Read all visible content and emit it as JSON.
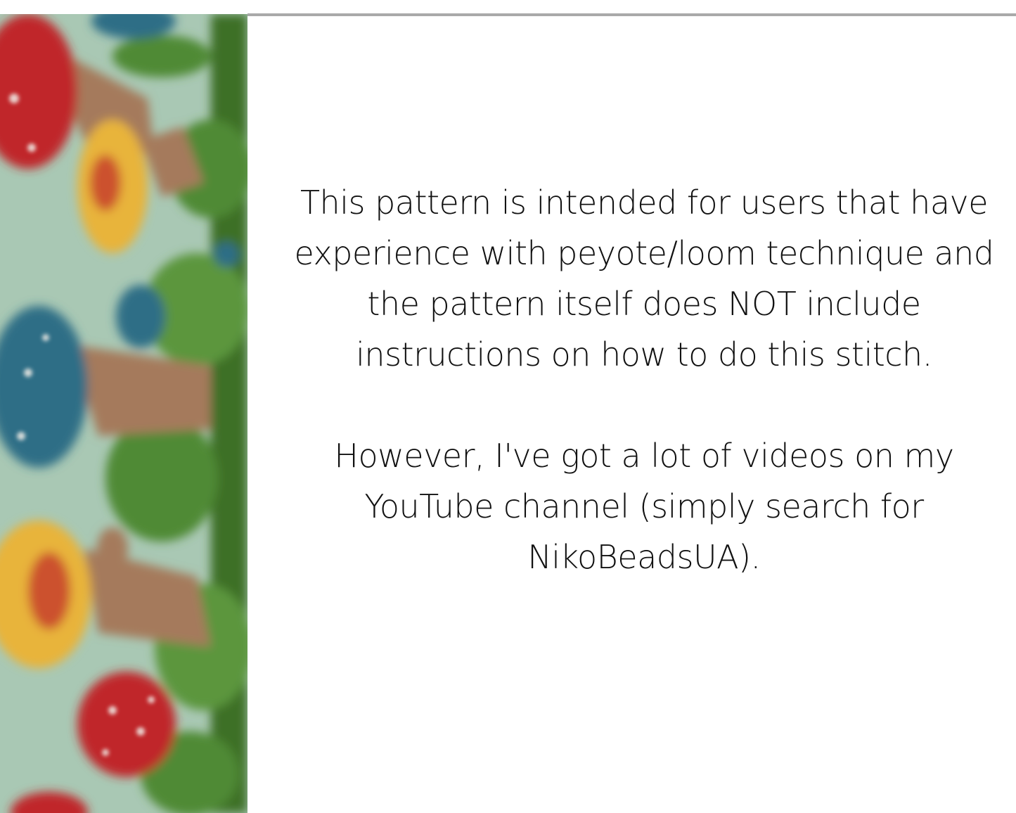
{
  "notice": {
    "paragraph_1": "This pattern is intended for users that have experience with peyote/loom technique and the pattern itself does NOT include instructions on how to do this stitch.",
    "paragraph_2": "However, I've got a lot of videos on my YouTube channel (simply search for NikoBeadsUA)."
  },
  "decor": {
    "image_name": "blurred-mushroom-bead-pattern",
    "colors": {
      "background": "#a9c8b4",
      "mushroom_red": "#c0262b",
      "mushroom_yellow": "#e8b43a",
      "mushroom_blue": "#2f6e86",
      "stem_brown": "#a57a5c",
      "foliage_green": "#3f7a2a",
      "divider": "#a9a9a9"
    }
  }
}
